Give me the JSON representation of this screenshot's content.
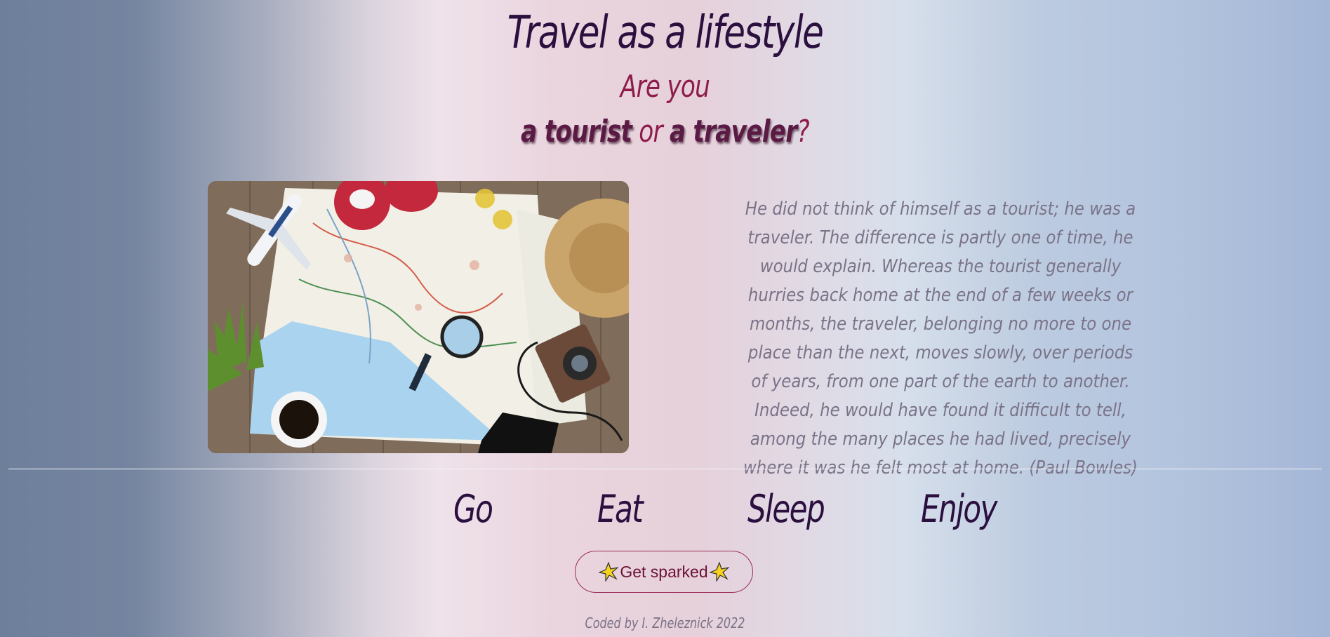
{
  "header": {
    "title": "Travel as a lifestyle",
    "line1": "Are you",
    "line2_a": "a tourist",
    "line2_or": " or ",
    "line2_b": "a traveler",
    "line2_q": "?"
  },
  "quote": {
    "text": "He did not think of himself as a tourist; he was a traveler. The difference is partly one of time, he would explain. Whereas the tourist generally hurries back home at the end of a few weeks or months, the traveler, belonging no more to one place than the next, moves slowly, over periods of years, from one part of the earth to another. Indeed, he would have found it difficult to tell, among the many places he had lived, precisely where it was he felt most at home. (Paul Bowles)"
  },
  "nav": {
    "items": [
      "Go",
      "Eat",
      "Sleep",
      "Enjoy"
    ]
  },
  "button": {
    "label": "Get sparked",
    "icon": "sparkle-icon"
  },
  "footer": {
    "text": "Coded by I. Zheleznick 2022"
  },
  "colors": {
    "title": "#2a0f3f",
    "accent": "#8e1c4b",
    "quote": "#7a7388"
  }
}
